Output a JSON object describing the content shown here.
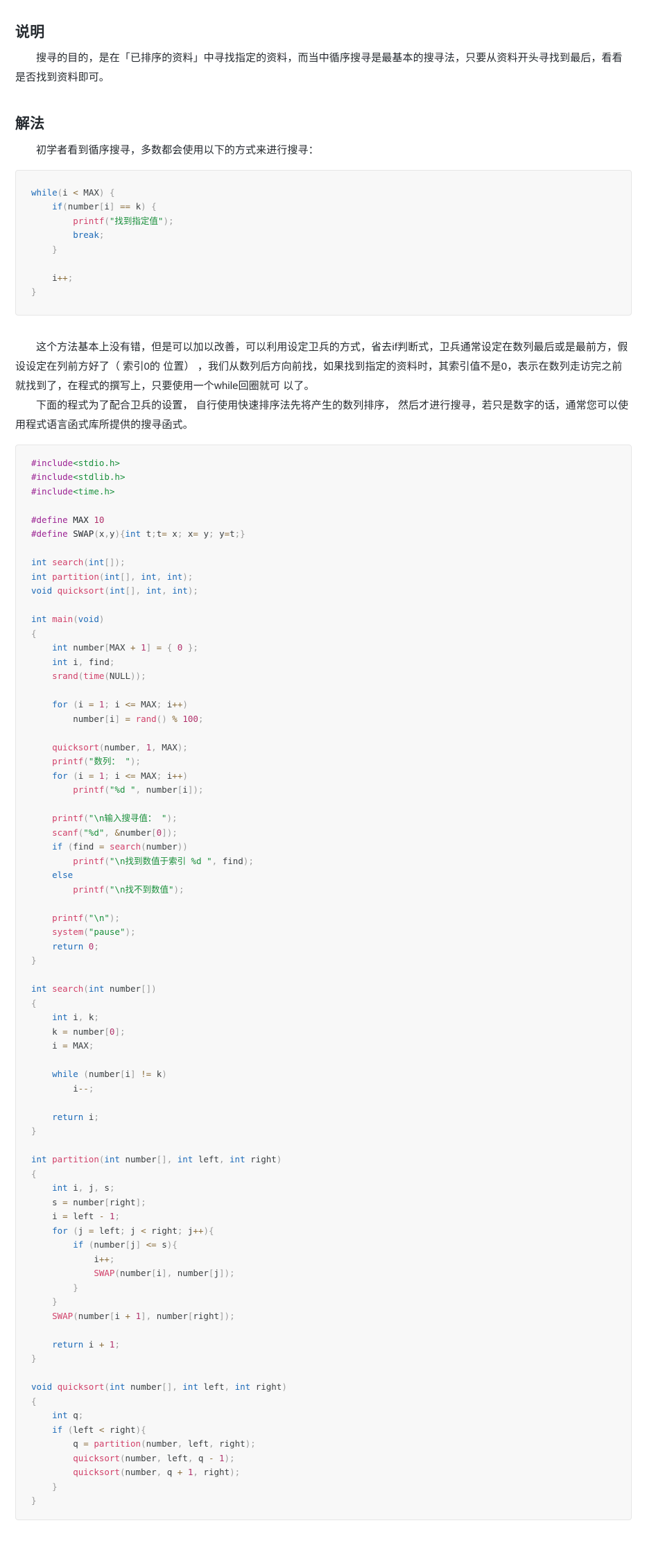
{
  "document": {
    "sections": [
      {
        "id": "description",
        "title": "说明",
        "paragraphs": [
          "搜寻的目的，是在「已排序的资料」中寻找指定的资料，而当中循序搜寻是最基本的搜寻法，只要从资料开头寻找到最后，看看是否找到资料即可。"
        ]
      },
      {
        "id": "solution",
        "title": "解法",
        "paragraphs": [
          "初学者看到循序搜寻，多数都会使用以下的方式来进行搜寻：",
          "这个方法基本上没有错，但是可以加以改善，可以利用设定卫兵的方式，省去if判断式，卫兵通常设定在数列最后或是最前方，假设设定在列前方好了（ 索引0的 位置） ，我们从数列后方向前找，如果找到指定的资料时，其索引值不是0，表示在数列走访完之前就找到了，在程式的撰写上，只要使用一个while回圈就可 以了。",
          "下面的程式为了配合卫兵的设置， 自行使用快速排序法先将产生的数列排序， 然后才进行搜寻，若只是数字的话，通常您可以使用程式语言函式库所提供的搜寻函式。"
        ]
      }
    ]
  },
  "code_blocks": {
    "naive_search": {
      "language": "c",
      "lines": [
        "while(i < MAX) {",
        "    if(number[i] == k) {",
        "        printf(\"找到指定值\");",
        "        break;",
        "    }",
        "",
        "    i++;",
        "}"
      ]
    },
    "full_program": {
      "language": "c",
      "lines": [
        "#include<stdio.h>",
        "#include<stdlib.h>",
        "#include<time.h>",
        "",
        "#define MAX 10",
        "#define SWAP(x,y){int t;t= x; x= y; y=t;}",
        "",
        "int search(int[]);",
        "int partition(int[], int, int);",
        "void quicksort(int[], int, int);",
        "",
        "int main(void)",
        "{",
        "    int number[MAX + 1] = { 0 };",
        "    int i, find;",
        "    srand(time(NULL));",
        "",
        "    for (i = 1; i <= MAX; i++)",
        "        number[i] = rand() % 100;",
        "",
        "    quicksort(number, 1, MAX);",
        "    printf(\"数列： \");",
        "    for (i = 1; i <= MAX; i++)",
        "        printf(\"%d \", number[i]);",
        "",
        "    printf(\"\\n输入搜寻值： \");",
        "    scanf(\"%d\", &number[0]);",
        "    if (find = search(number))",
        "        printf(\"\\n找到数值于索引 %d \", find);",
        "    else",
        "        printf(\"\\n找不到数值\");",
        "",
        "    printf(\"\\n\");",
        "    system(\"pause\");",
        "    return 0;",
        "}",
        "",
        "int search(int number[])",
        "{",
        "    int i, k;",
        "    k = number[0];",
        "    i = MAX;",
        "",
        "    while (number[i] != k)",
        "        i--;",
        "",
        "    return i;",
        "}",
        "",
        "int partition(int number[], int left, int right)",
        "{",
        "    int i, j, s;",
        "    s = number[right];",
        "    i = left - 1;",
        "    for (j = left; j < right; j++){",
        "        if (number[j] <= s){",
        "            i++;",
        "            SWAP(number[i], number[j]);",
        "        }",
        "    }",
        "    SWAP(number[i + 1], number[right]);",
        "",
        "    return i + 1;",
        "}",
        "",
        "void quicksort(int number[], int left, int right)",
        "{",
        "    int q;",
        "    if (left < right){",
        "        q = partition(number, left, right);",
        "        quicksort(number, left, q - 1);",
        "        quicksort(number, q + 1, right);",
        "    }",
        "}"
      ]
    }
  },
  "theme": {
    "page_background": "#ffffff",
    "text_color": "#24292e",
    "code_background": "#f8f8f8",
    "code_border": "#e6e6e6",
    "keyword_color": "#1e6bb8",
    "function_color": "#d1416a",
    "string_color": "#1a8f3c",
    "number_color": "#b0306a",
    "operator_color": "#8a6d3b",
    "preprocessor_color": "#9b2393",
    "punctuation_color": "#9a9a9a"
  }
}
